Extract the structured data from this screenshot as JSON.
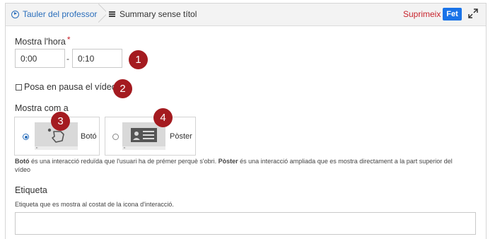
{
  "topbar": {
    "dashboard_label": "Tauler del professorat",
    "summary_label": "Summary sense títol",
    "delete_label": "Suprimeix",
    "done_label": "Fet"
  },
  "form": {
    "time": {
      "label": "Mostra l'hora",
      "required_mark": "*",
      "start_value": "0:00",
      "separator": "-",
      "end_value": "0:10"
    },
    "pause": {
      "label": "Posa en pausa el vídeo",
      "checked": false
    },
    "display_as": {
      "label": "Mostra com a",
      "options": [
        {
          "label": "Botó",
          "selected": true
        },
        {
          "label": "Pòster",
          "selected": false
        }
      ],
      "help_b1": "Botó",
      "help_t1": " és una interacció reduïda que l'usuari ha de prémer perquè s'obri. ",
      "help_b2": "Pòster",
      "help_t2": " és una interacció ampliada que es mostra directament a la part superior del vídeo"
    },
    "label_field": {
      "label": "Etiqueta",
      "description": "Etiqueta que es mostra al costat de la icona d'interacció.",
      "value": ""
    }
  },
  "annotations": [
    "1",
    "2",
    "3",
    "4"
  ],
  "colors": {
    "accent": "#1a73e8",
    "link": "#2a6ebb",
    "danger": "#c8232c",
    "badge": "#a41b20"
  }
}
